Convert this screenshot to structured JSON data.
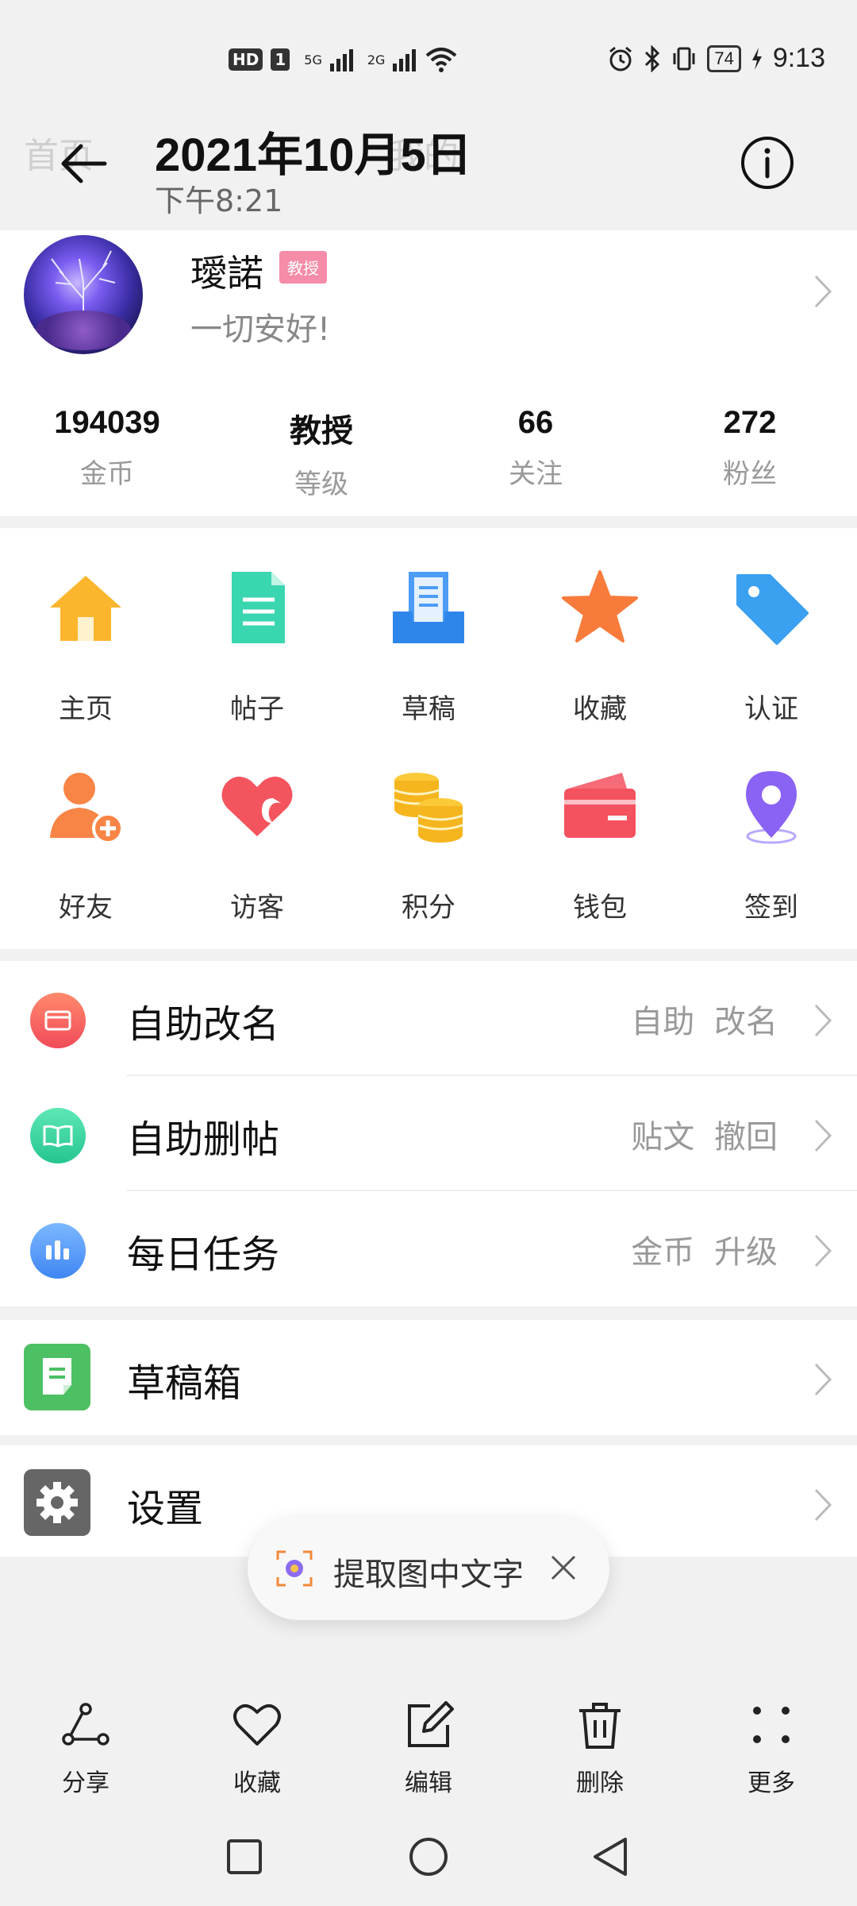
{
  "status": {
    "network_left": "HD",
    "sim": "1",
    "sig1": "5G",
    "sig2": "2G",
    "battery": "74",
    "time": "9:13"
  },
  "header": {
    "ghost_left": "首页",
    "ghost_mid": "我的",
    "title": "2021年10月5日",
    "subtitle": "下午8:21"
  },
  "profile": {
    "name": "璦諾",
    "badge": "教授",
    "motto": "一切安好!",
    "stats": [
      {
        "value": "194039",
        "label": "金币"
      },
      {
        "value": "教授",
        "label": "等级"
      },
      {
        "value": "66",
        "label": "关注"
      },
      {
        "value": "272",
        "label": "粉丝"
      }
    ]
  },
  "grid": [
    {
      "label": "主页",
      "icon": "home-icon"
    },
    {
      "label": "帖子",
      "icon": "post-icon"
    },
    {
      "label": "草稿",
      "icon": "draft-icon"
    },
    {
      "label": "收藏",
      "icon": "star-icon"
    },
    {
      "label": "认证",
      "icon": "tag-icon"
    },
    {
      "label": "好友",
      "icon": "add-friend-icon"
    },
    {
      "label": "访客",
      "icon": "visitor-icon"
    },
    {
      "label": "积分",
      "icon": "coins-icon"
    },
    {
      "label": "钱包",
      "icon": "wallet-icon"
    },
    {
      "label": "签到",
      "icon": "location-pin-icon"
    }
  ],
  "list1": [
    {
      "title": "自助改名",
      "hint": "自助 改名",
      "icon": "card-icon",
      "color": "#f4645a"
    },
    {
      "title": "自助删帖",
      "hint": "贴文 撤回",
      "icon": "book-icon",
      "color": "#39d6a2"
    },
    {
      "title": "每日任务",
      "hint": "金币 升级",
      "icon": "bar-chart-icon",
      "color": "#5a9cf8"
    }
  ],
  "list2": {
    "title": "草稿箱",
    "icon": "note-icon",
    "color": "#4cc063"
  },
  "list3": {
    "title": "设置",
    "icon": "gear-icon",
    "color": "#666666"
  },
  "toast": {
    "text": "提取图中文字"
  },
  "toolbar": [
    {
      "label": "分享",
      "icon": "share-icon"
    },
    {
      "label": "收藏",
      "icon": "heart-icon"
    },
    {
      "label": "编辑",
      "icon": "edit-icon"
    },
    {
      "label": "删除",
      "icon": "trash-icon"
    },
    {
      "label": "更多",
      "icon": "more-icon"
    }
  ]
}
